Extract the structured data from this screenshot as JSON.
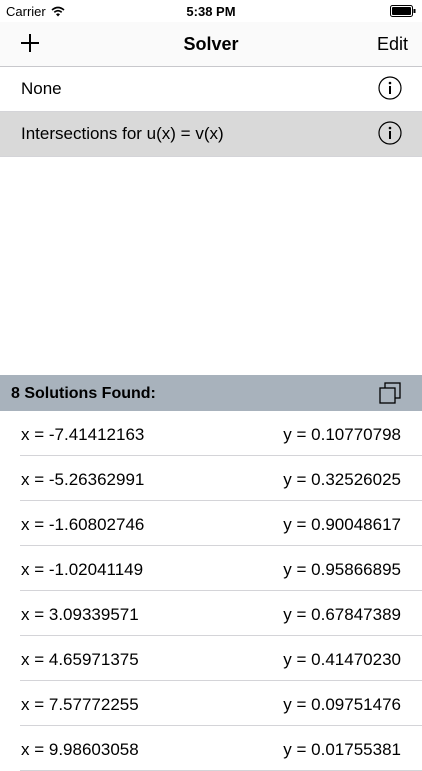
{
  "status_bar": {
    "carrier": "Carrier",
    "time": "5:38 PM"
  },
  "nav": {
    "title": "Solver",
    "edit_label": "Edit"
  },
  "equations": [
    {
      "label": "None",
      "selected": false
    },
    {
      "label": "Intersections for u(x) =  v(x)",
      "selected": true
    }
  ],
  "solutions": {
    "header": "8 Solutions Found:",
    "rows": [
      {
        "x": "x = -7.41412163",
        "y": "y = 0.10770798"
      },
      {
        "x": "x = -5.26362991",
        "y": "y = 0.32526025"
      },
      {
        "x": "x = -1.60802746",
        "y": "y = 0.90048617"
      },
      {
        "x": "x = -1.02041149",
        "y": "y = 0.95866895"
      },
      {
        "x": "x = 3.09339571",
        "y": "y = 0.67847389"
      },
      {
        "x": "x = 4.65971375",
        "y": "y = 0.41470230"
      },
      {
        "x": "x = 7.57772255",
        "y": "y = 0.09751476"
      },
      {
        "x": "x = 9.98603058",
        "y": "y = 0.01755381"
      }
    ]
  },
  "colors": {
    "header_bg": "#a8b2bc",
    "selected_bg": "#d9d9d9"
  }
}
